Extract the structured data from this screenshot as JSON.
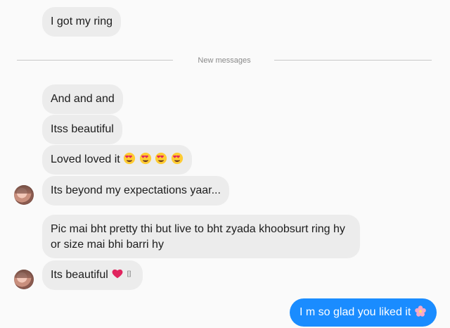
{
  "messages": {
    "m1": "I got my ring",
    "divider": "New messages",
    "m2": "And and and",
    "m3": "Itss beautiful",
    "m4": "Loved loved it",
    "m5": "Its beyond my expectations yaar...",
    "m6": "Pic mai bht pretty thi but live to bht zyada khoobsurt ring hy or size mai bhi barri hy",
    "m7": "Its beautiful",
    "m8": "I m so glad you liked it"
  },
  "icons": {
    "heart_eyes": "heart-eyes-emoji",
    "red_heart": "red-heart-emoji",
    "blossom": "blossom-emoji"
  },
  "colors": {
    "incoming_bubble": "#ececec",
    "outgoing_bubble": "#1a8cff",
    "background": "#fafafa"
  }
}
